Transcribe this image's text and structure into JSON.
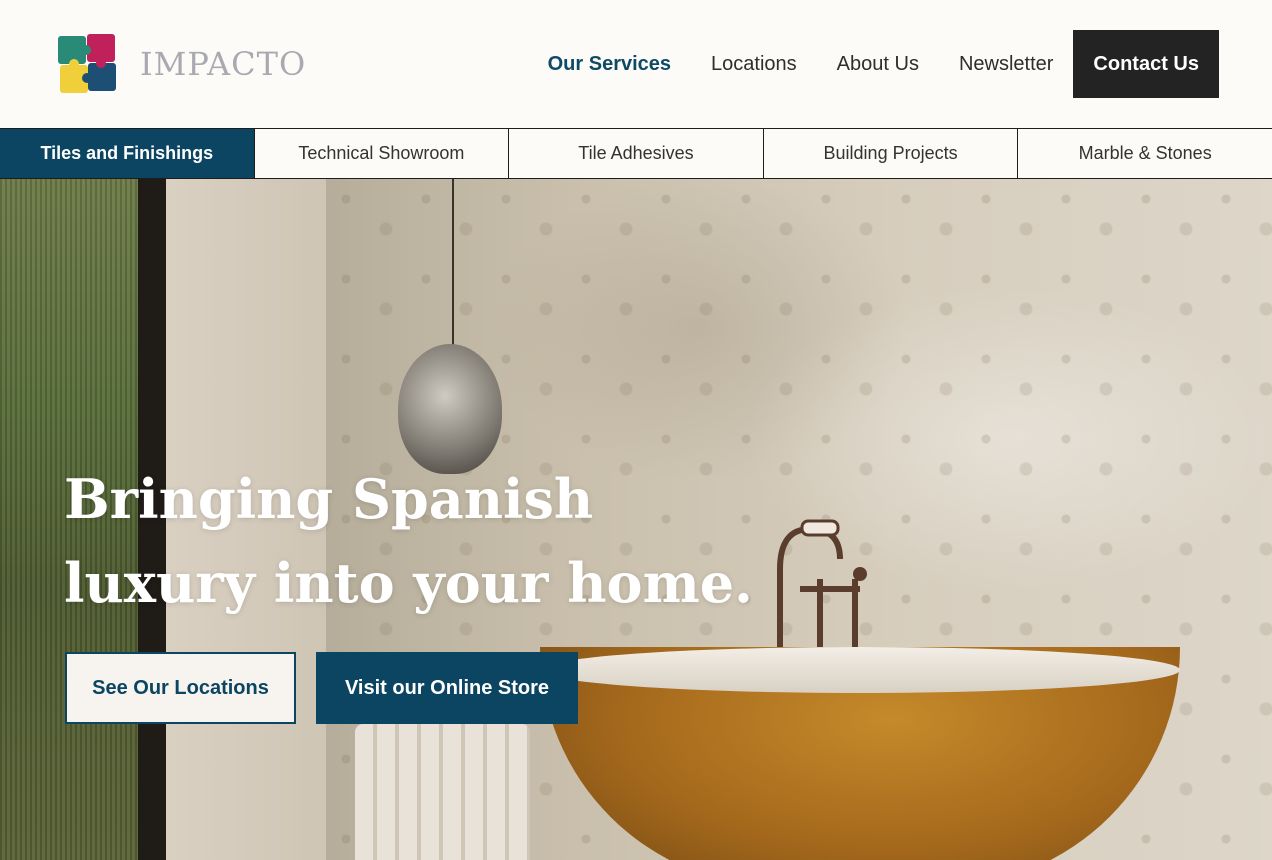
{
  "brand": {
    "name": "IMPACTO",
    "logo_icon": "puzzle-logo-icon",
    "colors": {
      "teal": "#2a8a78",
      "magenta": "#c0215a",
      "yellow": "#f0cf3a",
      "navy": "#1c4f73"
    }
  },
  "nav": {
    "items": [
      {
        "label": "Our Services",
        "active": true
      },
      {
        "label": "Locations"
      },
      {
        "label": "About Us"
      },
      {
        "label": "Newsletter"
      }
    ],
    "cta": "Contact Us"
  },
  "subnav": {
    "items": [
      {
        "label": "Tiles and Finishings",
        "active": true
      },
      {
        "label": "Technical Showroom"
      },
      {
        "label": "Tile Adhesives"
      },
      {
        "label": "Building  Projects"
      },
      {
        "label": "Marble & Stones"
      }
    ]
  },
  "hero": {
    "title": "Bringing Spanish luxury into your home.",
    "primary_button": "See Our Locations",
    "secondary_button": "Visit our Online Store"
  },
  "colors": {
    "accent": "#0b4561",
    "cta_dark": "#232323",
    "background": "#fdfbf8"
  }
}
